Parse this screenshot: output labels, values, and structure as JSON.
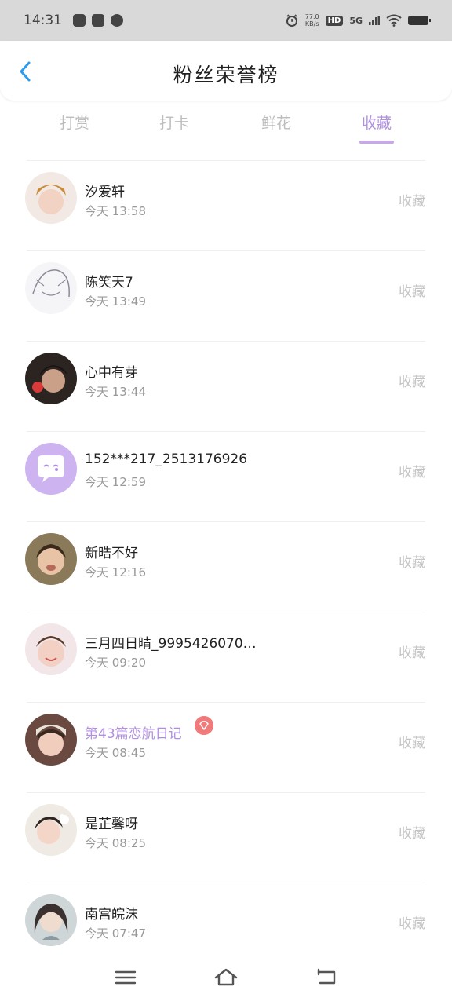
{
  "status_bar": {
    "time": "14:31",
    "speed_value": "77.0",
    "speed_unit": "KB/s",
    "hd": "HD",
    "network": "5G"
  },
  "header": {
    "title": "粉丝荣誉榜"
  },
  "tabs": [
    {
      "label": "打赏"
    },
    {
      "label": "打卡"
    },
    {
      "label": "鲜花"
    },
    {
      "label": "收藏"
    }
  ],
  "active_tab": "收藏",
  "accent_color": "#b08fe0",
  "rows": [
    {
      "name": "汐爱轩",
      "time": "今天 13:58",
      "action": "收藏"
    },
    {
      "name": "陈笑天7",
      "time": "今天 13:49",
      "action": "收藏"
    },
    {
      "name": "心中有芽",
      "time": "今天 13:44",
      "action": "收藏"
    },
    {
      "name": "152***217_2513176926",
      "time": "今天 12:59",
      "action": "收藏"
    },
    {
      "name": "新晧不好",
      "time": "今天 12:16",
      "action": "收藏"
    },
    {
      "name": "三月四日晴_9995426070…",
      "time": "今天 09:20",
      "action": "收藏"
    },
    {
      "name": "第43篇恋航日记",
      "time": "今天 08:45",
      "action": "收藏",
      "vip": true
    },
    {
      "name": "是芷馨呀",
      "time": "今天 08:25",
      "action": "收藏"
    },
    {
      "name": "南宫皖沫",
      "time": "今天 07:47",
      "action": "收藏"
    }
  ],
  "nav": {
    "icons": [
      "menu-icon",
      "home-icon",
      "back-icon"
    ]
  }
}
